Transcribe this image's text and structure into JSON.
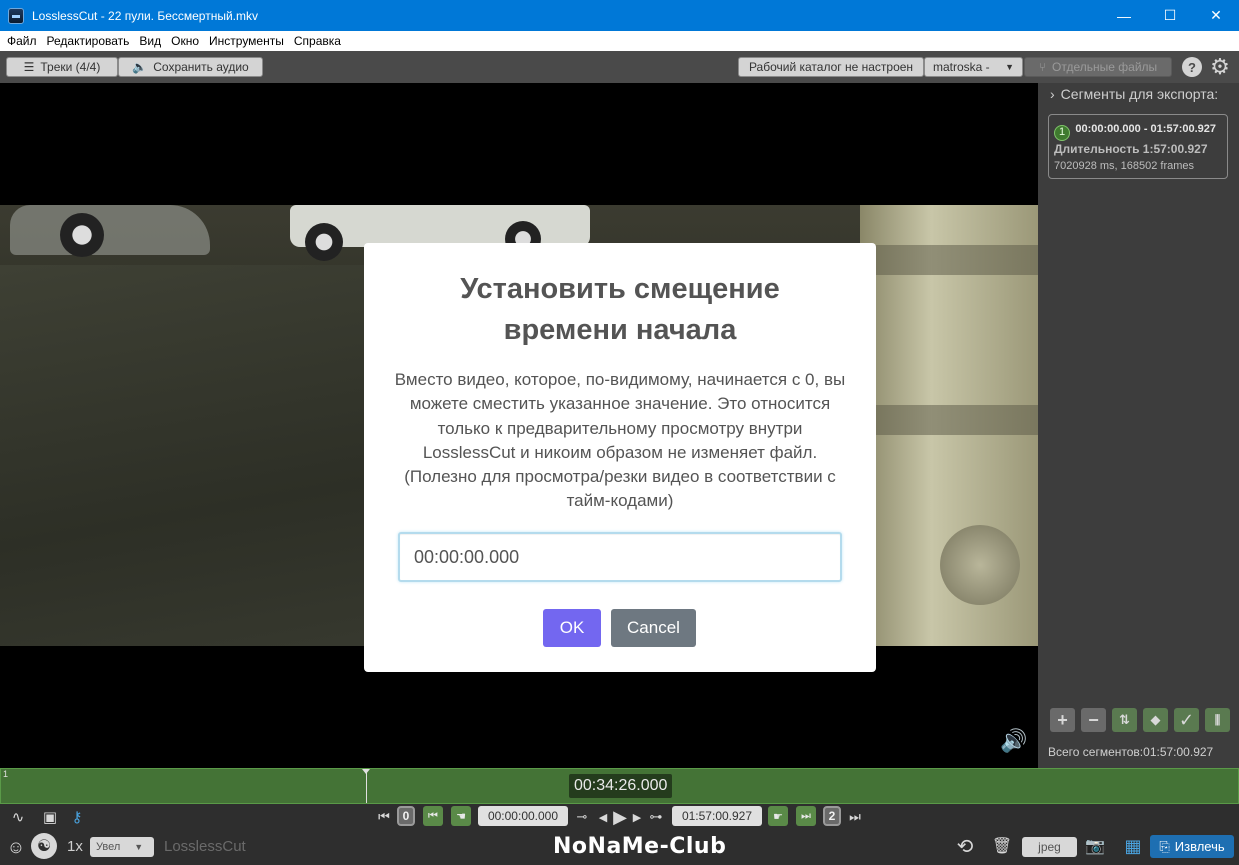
{
  "window": {
    "title": "LosslessCut - 22 пули. Бессмертный.mkv",
    "minimize": "—",
    "maximize": "☐",
    "close": "✕"
  },
  "menu": [
    "Файл",
    "Редактировать",
    "Вид",
    "Окно",
    "Инструменты",
    "Справка"
  ],
  "toolbar": {
    "tracks_label": "Треки (4/4)",
    "save_audio_label": "Сохранить аудио",
    "workdir_label": "Рабочий каталог не настроен",
    "format_label": "matroska -",
    "separate_files_label": "Отдельные файлы",
    "help_glyph": "?",
    "settings_glyph": "⚙"
  },
  "dialog": {
    "title": "Установить смещение времени начала",
    "text": "Вместо видео, которое, по-видимому, начинается с 0, вы можете сместить указанное значение. Это относится только к предварительному просмотру внутри LosslessCut и никоим образом не изменяет файл. (Полезно для просмотра/резки видео в соответствии с тайм-кодами)",
    "input_value": "00:00:00.000",
    "ok_label": "OK",
    "cancel_label": "Cancel"
  },
  "panel": {
    "heading": "Сегменты для экспорта:",
    "segments": [
      {
        "number": "1",
        "range": "00:00:00.000 - 01:57:00.927",
        "duration": "Длительность 1:57:00.927",
        "frames": "7020928 ms, 168502 frames"
      }
    ],
    "total": "Всего сегментов:01:57:00.927"
  },
  "timeline": {
    "tick_label": "1",
    "current_time": "00:34:26.000"
  },
  "controls": {
    "start_box": "0",
    "start_time": "00:00:00.000",
    "end_time": "01:57:00.927",
    "end_box": "2",
    "speed": "1x",
    "zoom_label": "Увел",
    "app_name": "LosslessCut",
    "watermark": "NoNaMe-Club",
    "capture_format": "jpeg",
    "export_label": "Извлечь"
  },
  "colors": {
    "titlebar": "#0078d7",
    "ok_button": "#7367f0",
    "cancel_button": "#6e7881",
    "timeline": "#447336",
    "export_button": "#1e6fb2"
  }
}
